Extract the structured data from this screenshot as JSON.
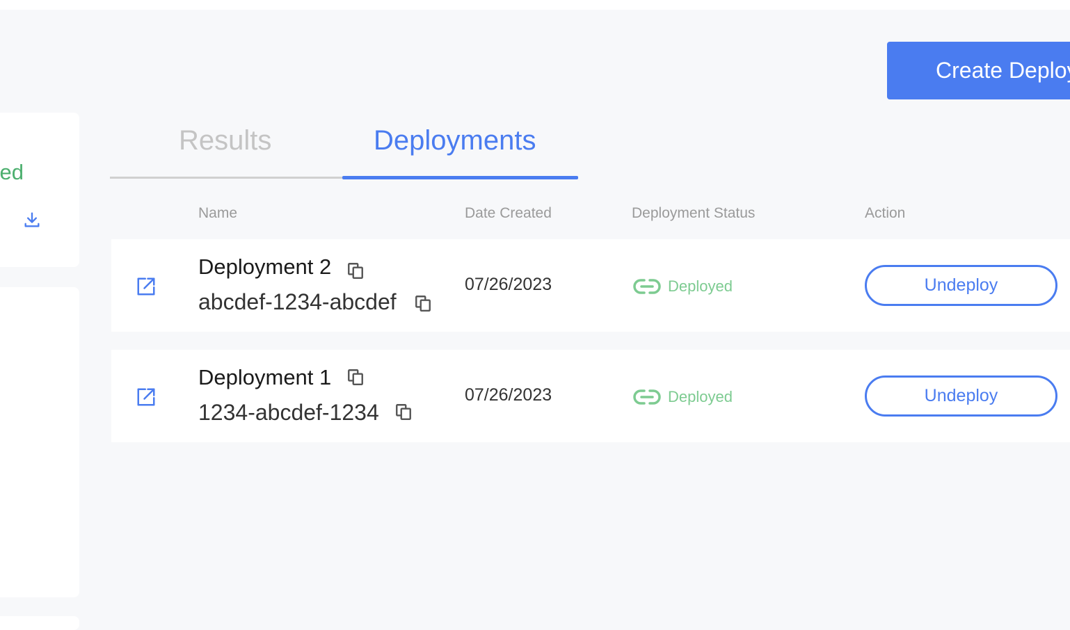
{
  "header": {
    "create_button_label": "Create Deploy"
  },
  "left_panel": {
    "status_partial_text": "ed",
    "download_icon": "download-icon"
  },
  "tabs": [
    {
      "label": "Results",
      "active": false
    },
    {
      "label": "Deployments",
      "active": true
    }
  ],
  "table": {
    "columns": [
      "Name",
      "Date Created",
      "Deployment Status",
      "Action"
    ],
    "rows": [
      {
        "name": "Deployment 2",
        "id": "abcdef-1234-abcdef",
        "date_created": "07/26/2023",
        "status": "Deployed",
        "action_label": "Undeploy"
      },
      {
        "name": "Deployment 1",
        "id": "1234-abcdef-1234",
        "date_created": "07/26/2023",
        "status": "Deployed",
        "action_label": "Undeploy"
      }
    ]
  },
  "colors": {
    "accent": "#4a7cf0",
    "status_green": "#7dcb91",
    "left_status_green": "#4caf6e",
    "tab_inactive": "#c4c4c4",
    "background": "#f7f8fa"
  }
}
